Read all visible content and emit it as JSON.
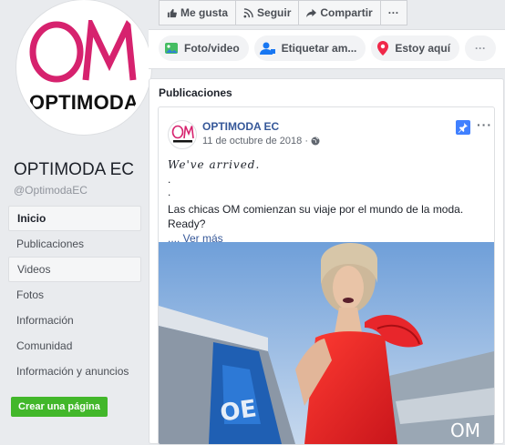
{
  "page": {
    "logo_text": "OPTIMODA",
    "name": "OPTIMODA EC",
    "handle": "@OptimodaEC"
  },
  "nav": [
    {
      "label": "Inicio"
    },
    {
      "label": "Publicaciones"
    },
    {
      "label": "Videos"
    },
    {
      "label": "Fotos"
    },
    {
      "label": "Información"
    },
    {
      "label": "Comunidad"
    },
    {
      "label": "Información y anuncios"
    }
  ],
  "create_page_label": "Crear una página",
  "topbar": {
    "like": "Me gusta",
    "follow": "Seguir",
    "share": "Compartir",
    "more": "···"
  },
  "composer": {
    "photo_video": "Foto/video",
    "tag": "Etiquetar am...",
    "checkin": "Estoy aquí",
    "more": "···"
  },
  "publications": {
    "title": "Publicaciones",
    "post": {
      "author": "OPTIMODA EC",
      "date": "11 de octubre de 2018 ·",
      "script_line": "We've arrived.",
      "dot1": ".",
      "dot2": ".",
      "text": "Las chicas OM comienzan su viaje por el mundo de la moda. Ready?",
      "see_more": ".... Ver más",
      "more": "···"
    }
  },
  "colors": {
    "brand_magenta": "#d6226e",
    "link_blue": "#365899",
    "green": "#42b72a"
  }
}
